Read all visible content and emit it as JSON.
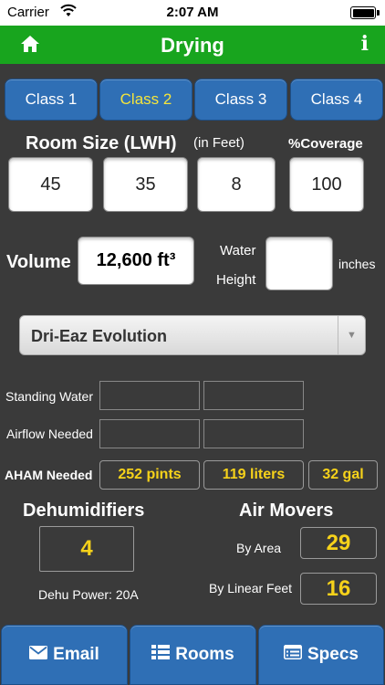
{
  "status_bar": {
    "carrier": "Carrier",
    "time": "2:07 AM",
    "battery_level": 1.0
  },
  "nav": {
    "title": "Drying",
    "info_label": "i"
  },
  "class_tabs": [
    {
      "label": "Class 1",
      "selected": false
    },
    {
      "label": "Class 2",
      "selected": true
    },
    {
      "label": "Class 3",
      "selected": false
    },
    {
      "label": "Class 4",
      "selected": false
    }
  ],
  "room": {
    "title": "Room Size (LWH)",
    "units": "(in Feet)",
    "coverage_label": "%Coverage",
    "length": "45",
    "width": "35",
    "height": "8",
    "coverage": "100"
  },
  "volume": {
    "label": "Volume",
    "value": "12,600 ft³",
    "water_label": "Water",
    "height_label": "Height",
    "water_height": "",
    "unit": "inches"
  },
  "dehumidifier_model": "Dri-Eaz Evolution",
  "rows": {
    "standing_water": {
      "label": "Standing Water",
      "a": "",
      "b": ""
    },
    "airflow_needed": {
      "label": "Airflow Needed",
      "a": "",
      "b": ""
    },
    "aham_needed": {
      "label": "AHAM Needed",
      "pints": "252 pints",
      "liters": "119 liters",
      "gal": "32 gal"
    }
  },
  "dehumidifiers": {
    "title": "Dehumidifiers",
    "count": "4",
    "power": "Dehu Power: 20A"
  },
  "air_movers": {
    "title": "Air Movers",
    "by_area_label": "By Area",
    "by_area": "29",
    "by_linear_label": "By Linear Feet",
    "by_linear": "16"
  },
  "bottom_buttons": {
    "email": "Email",
    "rooms": "Rooms",
    "specs": "Specs"
  },
  "colors": {
    "nav_green": "#18a51e",
    "button_blue": "#2f6fb5",
    "value_yellow": "#f6d21a",
    "background": "#3a3a3a"
  }
}
